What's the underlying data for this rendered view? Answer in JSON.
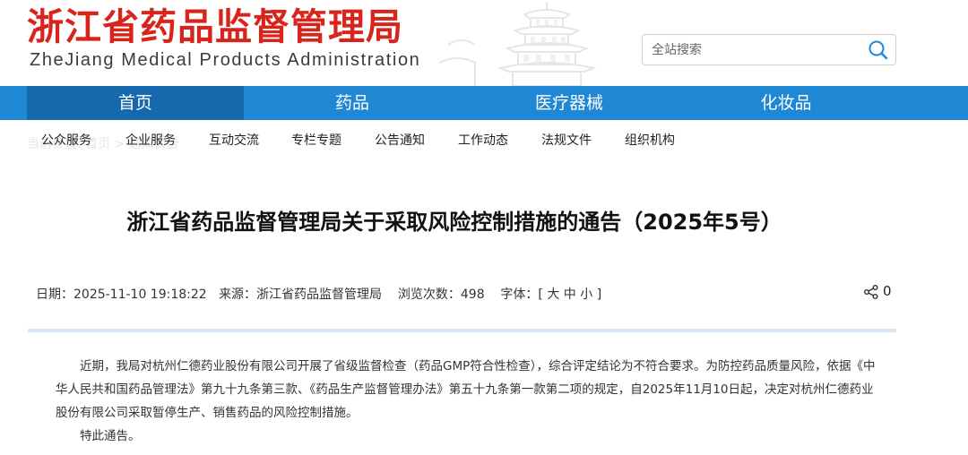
{
  "header": {
    "logo_cn": "浙江省药品监督管理局",
    "logo_en": "ZheJiang Medical Products Administration"
  },
  "search": {
    "placeholder": "全站搜索",
    "icon": "search-icon"
  },
  "nav": {
    "items": [
      {
        "label": "首页",
        "active": true
      },
      {
        "label": "药品",
        "active": false
      },
      {
        "label": "医疗器械",
        "active": false
      },
      {
        "label": "化妆品",
        "active": false
      }
    ]
  },
  "subnav": {
    "breadcrumb_ghost": "当前位置: 首页 > 通知公告",
    "items": [
      "公众服务",
      "企业服务",
      "互动交流",
      "专栏专题",
      "公告通知",
      "工作动态",
      "法规文件",
      "组织机构"
    ]
  },
  "article": {
    "title": "浙江省药品监督管理局关于采取风险控制措施的通告（2025年5号）",
    "meta": {
      "date_label": "日期：",
      "date": "2025-11-10 19:18:22",
      "source_label": "来源：",
      "source": "浙江省药品监督管理局",
      "views_label": "浏览次数：",
      "views": "498",
      "font_label": "字体：[",
      "font_large": "大",
      "font_medium": "中",
      "font_small": "小",
      "font_end": "]"
    },
    "share_count": "0",
    "paragraphs": [
      "近期，我局对杭州仁德药业股份有限公司开展了省级监督检查（药品GMP符合性检查），综合评定结论为不符合要求。为防控药品质量风险，依据《中华人民共和国药品管理法》第九十九条第三款、《药品生产监督管理办法》第五十九条第一款第二项的规定，自2025年11月10日起，决定对杭州仁德药业股份有限公司采取暂停生产、销售药品的风险控制措施。",
      "特此通告。"
    ]
  },
  "colors": {
    "brand_red": "#d9241c",
    "nav_blue": "#1f87d3",
    "nav_active": "#1769ad",
    "divider": "#d6e5f3"
  }
}
